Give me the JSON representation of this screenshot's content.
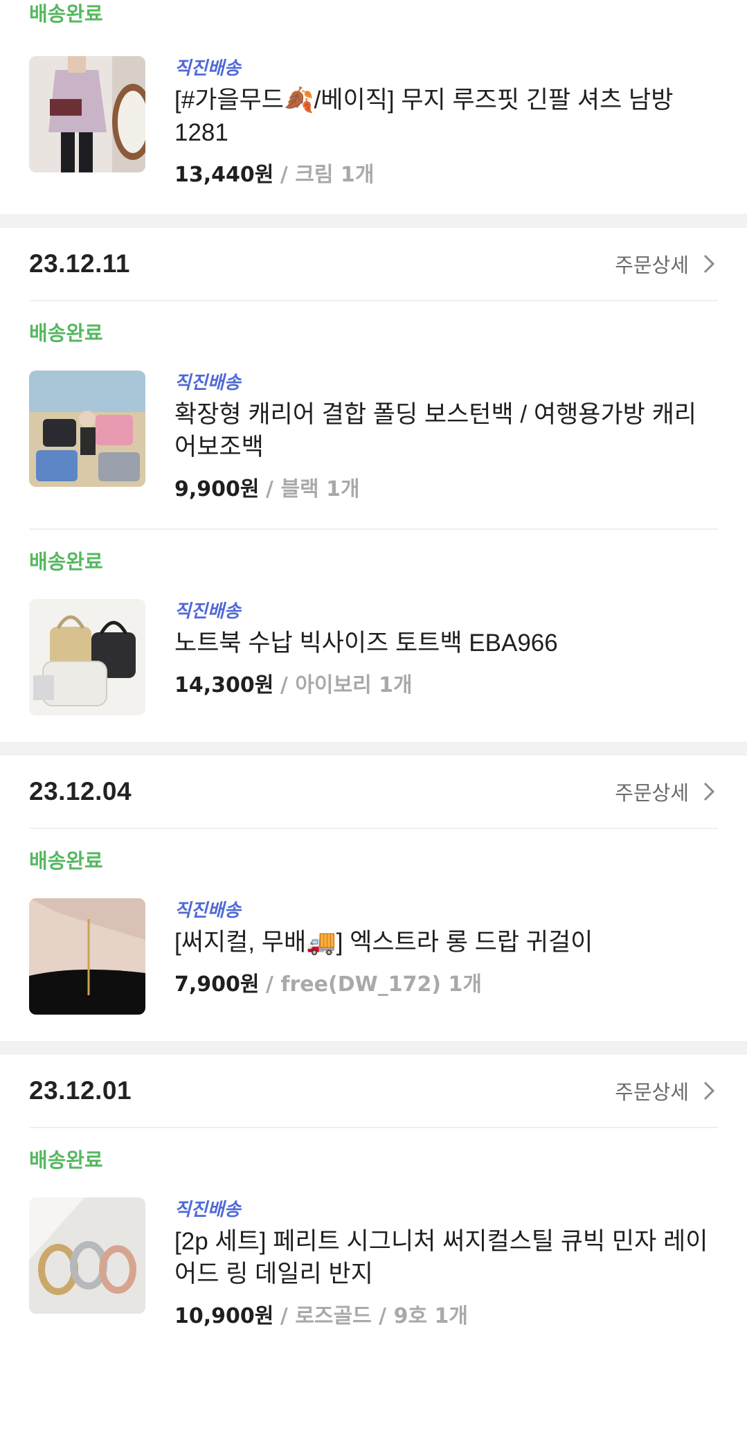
{
  "orders": [
    {
      "items": [
        {
          "status": "배송완료",
          "tag": "직진배송",
          "title": "[#가을무드🍂/베이직] 무지 루즈핏 긴팔 셔츠 남방 1281",
          "price": "13,440원",
          "option": "/ 크림 1개"
        }
      ]
    },
    {
      "date": "23.12.11",
      "detail_label": "주문상세",
      "items": [
        {
          "status": "배송완료",
          "tag": "직진배송",
          "title": "확장형 캐리어 결합 폴딩 보스턴백 / 여행용가방 캐리어보조백",
          "price": "9,900원",
          "option": "/ 블랙 1개"
        },
        {
          "status": "배송완료",
          "tag": "직진배송",
          "title": "노트북 수납 빅사이즈 토트백 EBA966",
          "price": "14,300원",
          "option": "/ 아이보리 1개"
        }
      ]
    },
    {
      "date": "23.12.04",
      "detail_label": "주문상세",
      "items": [
        {
          "status": "배송완료",
          "tag": "직진배송",
          "title": "[써지컬, 무배🚚] 엑스트라 롱 드랍 귀걸이",
          "price": "7,900원",
          "option": "/ free(DW_172) 1개"
        }
      ]
    },
    {
      "date": "23.12.01",
      "detail_label": "주문상세",
      "items": [
        {
          "status": "배송완료",
          "tag": "직진배송",
          "title": "[2p 세트] 페리트 시그니처 써지컬스틸 큐빅 민자 레이어드 링 데일리 반지",
          "price": "10,900원",
          "option": "/ 로즈골드 / 9호 1개"
        }
      ]
    }
  ],
  "colors": {
    "status_green": "#55b85f",
    "tag_blue": "#4f69d8",
    "option_gray": "#a9a9a9",
    "band_gray": "#f2f2f2"
  }
}
